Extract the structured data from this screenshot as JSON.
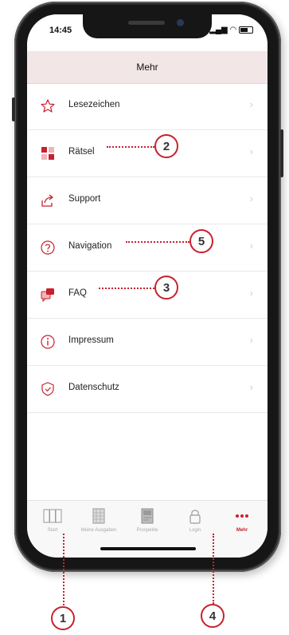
{
  "status_bar": {
    "time": "14:45"
  },
  "header": {
    "title": "Mehr"
  },
  "menu": [
    {
      "label": "Lesezeichen",
      "icon": "star-icon"
    },
    {
      "label": "Rätsel",
      "icon": "puzzle-icon"
    },
    {
      "label": "Support",
      "icon": "share-icon"
    },
    {
      "label": "Navigation",
      "icon": "question-circle-icon"
    },
    {
      "label": "FAQ",
      "icon": "chat-bubbles-icon"
    },
    {
      "label": "Impressum",
      "icon": "info-circle-icon"
    },
    {
      "label": "Datenschutz",
      "icon": "shield-icon"
    }
  ],
  "tabs": [
    {
      "label": "Start",
      "icon": "pages-icon"
    },
    {
      "label": "Meine Ausgaben",
      "icon": "grid-icon"
    },
    {
      "label": "Prospekte",
      "icon": "brochure-icon"
    },
    {
      "label": "Login",
      "icon": "lock-icon"
    },
    {
      "label": "Mehr",
      "icon": "more-dots-icon",
      "active": true
    }
  ],
  "callouts": [
    "2",
    "5",
    "3",
    "1",
    "4"
  ],
  "colors": {
    "accent": "#c7212e",
    "header_bg": "#f3e6e6",
    "chevron": "#cfcfcf"
  }
}
